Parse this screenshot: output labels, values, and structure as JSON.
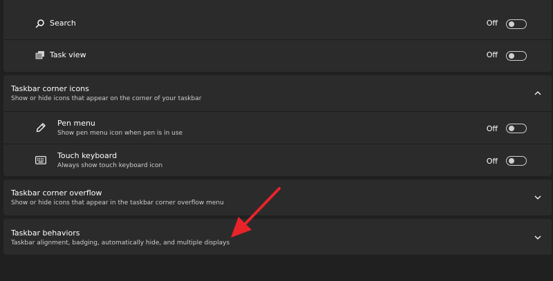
{
  "sections": {
    "top": {
      "items": [
        {
          "label": "Search",
          "icon": "search-icon",
          "state": "Off"
        },
        {
          "label": "Task view",
          "icon": "task-view-icon",
          "state": "Off"
        }
      ]
    },
    "corner_icons": {
      "title": "Taskbar corner icons",
      "subtitle": "Show or hide icons that appear on the corner of your taskbar",
      "expanded": true,
      "items": [
        {
          "label": "Pen menu",
          "description": "Show pen menu icon when pen is in use",
          "icon": "pen-icon",
          "state": "Off"
        },
        {
          "label": "Touch keyboard",
          "description": "Always show touch keyboard icon",
          "icon": "keyboard-icon",
          "state": "Off"
        }
      ]
    },
    "corner_overflow": {
      "title": "Taskbar corner overflow",
      "subtitle": "Show or hide icons that appear in the taskbar corner overflow menu",
      "expanded": false
    },
    "behaviors": {
      "title": "Taskbar behaviors",
      "subtitle": "Taskbar alignment, badging, automatically hide, and multiple displays",
      "expanded": false
    }
  },
  "colors": {
    "background": "#202020",
    "panel": "#2b2b2b",
    "annotation_arrow": "#e8232a"
  }
}
